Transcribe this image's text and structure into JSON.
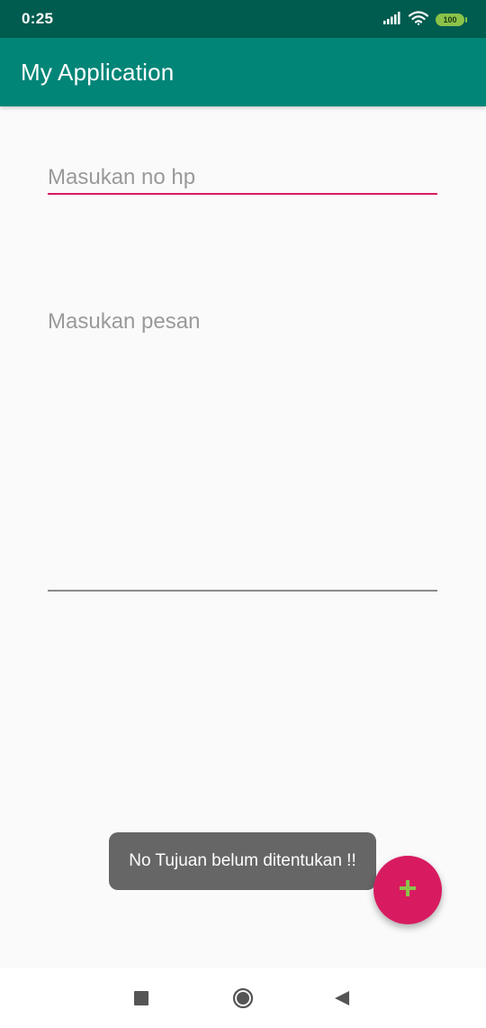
{
  "status_bar": {
    "time": "0:25",
    "battery_level": "100",
    "icons": [
      "signal-icon",
      "wifi-icon",
      "battery-icon"
    ]
  },
  "app_bar": {
    "title": "My Application",
    "color": "#008577"
  },
  "form": {
    "phone": {
      "placeholder": "Masukan no hp",
      "value": "",
      "focused": true,
      "accent_color": "#d81b60"
    },
    "message": {
      "placeholder": "Masukan pesan",
      "value": ""
    }
  },
  "toast": {
    "text": "No Tujuan belum ditentukan !!"
  },
  "fab": {
    "icon": "plus-icon",
    "color": "#d81b60",
    "icon_color": "#8bc34a"
  },
  "nav_bar": {
    "icons": [
      "recents-icon",
      "home-icon",
      "back-icon"
    ]
  }
}
